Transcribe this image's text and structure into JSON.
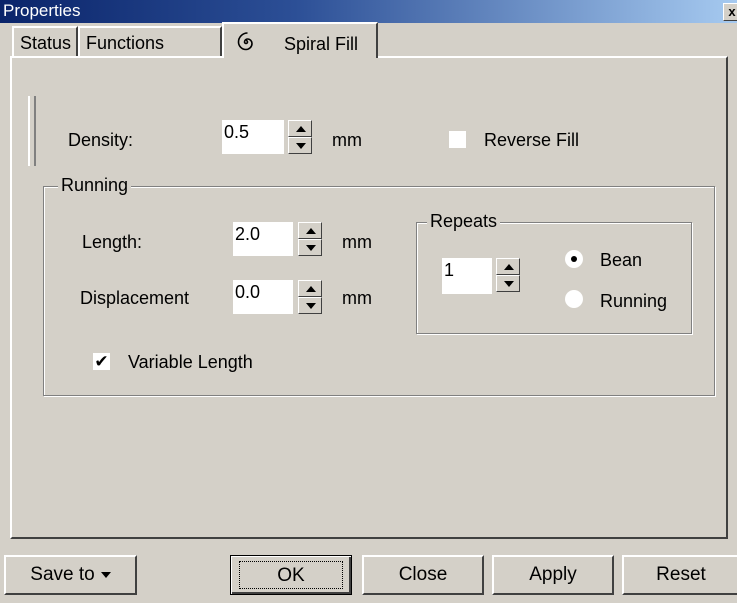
{
  "window": {
    "title": "Properties",
    "close_glyph": "x"
  },
  "tabs": [
    {
      "label": "Status"
    },
    {
      "label": "Functions"
    },
    {
      "label": "Spiral Fill",
      "icon": "spiral-icon",
      "active": true
    }
  ],
  "density": {
    "label": "Density:",
    "value": "0.5",
    "unit": "mm"
  },
  "reverse_fill": {
    "label": "Reverse Fill",
    "checked": false
  },
  "running": {
    "title": "Running",
    "length": {
      "label": "Length:",
      "value": "2.0",
      "unit": "mm"
    },
    "displacement": {
      "label": "Displacement",
      "value": "0.0",
      "unit": "mm"
    },
    "variable_length": {
      "label": "Variable Length",
      "checked": true,
      "mark": "✔"
    }
  },
  "repeats": {
    "title": "Repeats",
    "value": "1",
    "options": [
      {
        "label": "Bean",
        "selected": true
      },
      {
        "label": "Running",
        "selected": false
      }
    ]
  },
  "buttons": {
    "save_to": "Save to",
    "ok": "OK",
    "close": "Close",
    "apply": "Apply",
    "reset": "Reset"
  },
  "colors": {
    "title_bar_start": "#0a246a",
    "title_bar_end": "#a6caf0",
    "face": "#d4d0c8"
  }
}
